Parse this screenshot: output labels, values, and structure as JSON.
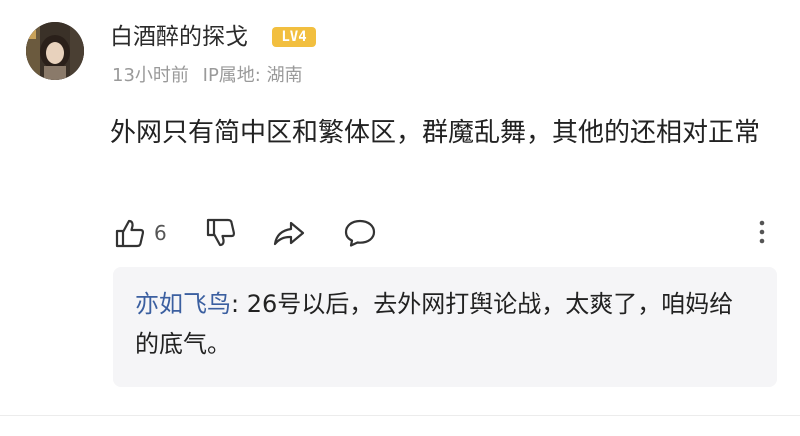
{
  "comment": {
    "username": "白酒醉的探戈",
    "level": "LV4",
    "time": "13小时前",
    "ip_location": "IP属地: 湖南",
    "content": "外网只有简中区和繁体区，群魔乱舞，其他的还相对正常"
  },
  "actions": {
    "like_count": "6",
    "icons": [
      "thumbs-up-icon",
      "thumbs-down-icon",
      "share-icon",
      "comment-icon",
      "more-icon"
    ]
  },
  "reply": {
    "author": "亦如飞鸟",
    "text": ": 26号以后，去外网打舆论战，太爽了，咱妈给的底气。"
  },
  "colors": {
    "badge": "#f2bf3f",
    "reply_author": "#3b5fa0",
    "reply_background": "#f5f5f7",
    "meta_text": "#9a9a9a"
  }
}
